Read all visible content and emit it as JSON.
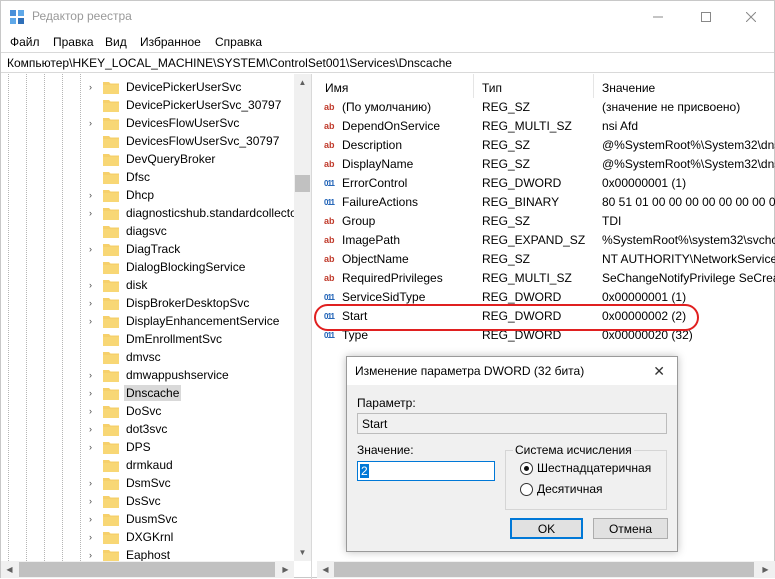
{
  "window": {
    "title": "Редактор реестра"
  },
  "menu": [
    "Файл",
    "Правка",
    "Вид",
    "Избранное",
    "Справка"
  ],
  "address": "Компьютер\\HKEY_LOCAL_MACHINE\\SYSTEM\\ControlSet001\\Services\\Dnscache",
  "tree": {
    "items": [
      {
        "label": "DevicePickerUserSvc",
        "expander": "›"
      },
      {
        "label": "DevicePickerUserSvc_30797",
        "expander": ""
      },
      {
        "label": "DevicesFlowUserSvc",
        "expander": "›"
      },
      {
        "label": "DevicesFlowUserSvc_30797",
        "expander": ""
      },
      {
        "label": "DevQueryBroker",
        "expander": ""
      },
      {
        "label": "Dfsc",
        "expander": ""
      },
      {
        "label": "Dhcp",
        "expander": "›"
      },
      {
        "label": "diagnosticshub.standardcollecto",
        "expander": "›"
      },
      {
        "label": "diagsvc",
        "expander": ""
      },
      {
        "label": "DiagTrack",
        "expander": "›"
      },
      {
        "label": "DialogBlockingService",
        "expander": ""
      },
      {
        "label": "disk",
        "expander": "›"
      },
      {
        "label": "DispBrokerDesktopSvc",
        "expander": "›"
      },
      {
        "label": "DisplayEnhancementService",
        "expander": "›"
      },
      {
        "label": "DmEnrollmentSvc",
        "expander": ""
      },
      {
        "label": "dmvsc",
        "expander": ""
      },
      {
        "label": "dmwappushservice",
        "expander": "›"
      },
      {
        "label": "Dnscache",
        "expander": "›",
        "selected": true
      },
      {
        "label": "DoSvc",
        "expander": "›"
      },
      {
        "label": "dot3svc",
        "expander": "›"
      },
      {
        "label": "DPS",
        "expander": "›"
      },
      {
        "label": "drmkaud",
        "expander": ""
      },
      {
        "label": "DsmSvc",
        "expander": "›"
      },
      {
        "label": "DsSvc",
        "expander": "›"
      },
      {
        "label": "DusmSvc",
        "expander": "›"
      },
      {
        "label": "DXGKrnl",
        "expander": "›"
      },
      {
        "label": "Eaphost",
        "expander": "›"
      }
    ]
  },
  "list": {
    "headers": [
      "Имя",
      "Тип",
      "Значение"
    ],
    "rows": [
      {
        "icon": "sz",
        "name": "(По умолчанию)",
        "type": "REG_SZ",
        "value": "(значение не присвоено)"
      },
      {
        "icon": "sz",
        "name": "DependOnService",
        "type": "REG_MULTI_SZ",
        "value": "nsi Afd"
      },
      {
        "icon": "sz",
        "name": "Description",
        "type": "REG_SZ",
        "value": "@%SystemRoot%\\System32\\dns"
      },
      {
        "icon": "sz",
        "name": "DisplayName",
        "type": "REG_SZ",
        "value": "@%SystemRoot%\\System32\\dns"
      },
      {
        "icon": "bin",
        "name": "ErrorControl",
        "type": "REG_DWORD",
        "value": "0x00000001 (1)"
      },
      {
        "icon": "bin",
        "name": "FailureActions",
        "type": "REG_BINARY",
        "value": "80 51 01 00 00 00 00 00 00 00 00 0"
      },
      {
        "icon": "sz",
        "name": "Group",
        "type": "REG_SZ",
        "value": "TDI"
      },
      {
        "icon": "sz",
        "name": "ImagePath",
        "type": "REG_EXPAND_SZ",
        "value": "%SystemRoot%\\system32\\svchc"
      },
      {
        "icon": "sz",
        "name": "ObjectName",
        "type": "REG_SZ",
        "value": "NT AUTHORITY\\NetworkService"
      },
      {
        "icon": "sz",
        "name": "RequiredPrivileges",
        "type": "REG_MULTI_SZ",
        "value": "SeChangeNotifyPrivilege SeCreat"
      },
      {
        "icon": "bin",
        "name": "ServiceSidType",
        "type": "REG_DWORD",
        "value": "0x00000001 (1)"
      },
      {
        "icon": "bin",
        "name": "Start",
        "type": "REG_DWORD",
        "value": "0x00000002 (2)"
      },
      {
        "icon": "bin",
        "name": "Type",
        "type": "REG_DWORD",
        "value": "0x00000020 (32)"
      }
    ]
  },
  "dialog": {
    "title": "Изменение параметра DWORD (32 бита)",
    "param_label": "Параметр:",
    "param_value": "Start",
    "value_label": "Значение:",
    "value_input": "2",
    "base_label": "Система исчисления",
    "base_options": [
      "Шестнадцатеричная",
      "Десятичная"
    ],
    "base_selected": "Шестнадцатеричная",
    "ok": "OK",
    "cancel": "Отмена"
  },
  "icons": {
    "close": "close-icon",
    "minimize": "minimize-icon",
    "maximize": "maximize-icon"
  },
  "colors": {
    "highlight_ellipse": "#e02020",
    "selection": "#0078d7",
    "folder": "#f6d06b"
  }
}
